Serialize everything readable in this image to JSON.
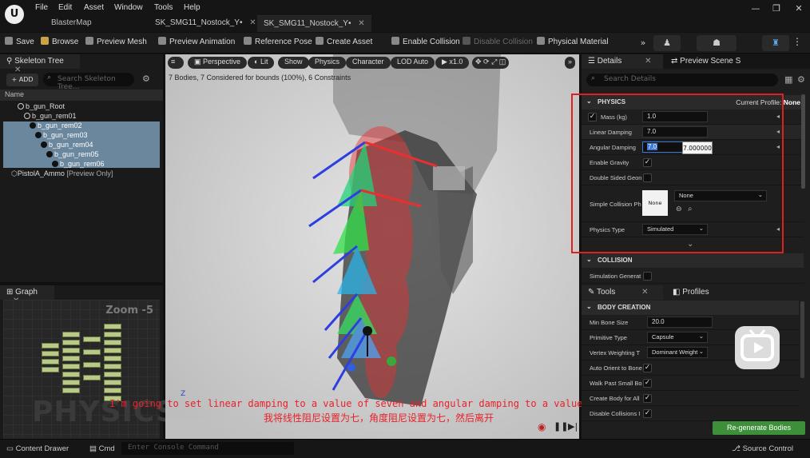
{
  "menu": [
    "File",
    "Edit",
    "Asset",
    "Window",
    "Tools",
    "Help"
  ],
  "project_tab": "BlasterMap",
  "doc_tabs": [
    "SK_SMG11_Nostock_Y•",
    "SK_SMG11_Nostock_Y•"
  ],
  "window_controls": [
    "—",
    "❐",
    "✕"
  ],
  "toolbar": {
    "save": "Save",
    "browse": "Browse",
    "preview_mesh": "Preview Mesh",
    "preview_animation": "Preview Animation",
    "reference_pose": "Reference Pose",
    "create_asset": "Create Asset",
    "enable_collision": "Enable Collision",
    "disable_collision": "Disable Collision",
    "physical_material": "Physical Material"
  },
  "skeleton_tree": {
    "tab": "Skeleton Tree",
    "add_label": "ADD",
    "search_placeholder": "Search Skeleton Tree...",
    "header": "Name",
    "bones": [
      {
        "name": "b_gun_Root",
        "indent": 1,
        "selected": false
      },
      {
        "name": "b_gun_rem01",
        "indent": 2,
        "selected": false
      },
      {
        "name": "b_gun_rem02",
        "indent": 3,
        "selected": true
      },
      {
        "name": "b_gun_rem03",
        "indent": 4,
        "selected": true
      },
      {
        "name": "b_gun_rem04",
        "indent": 5,
        "selected": true
      },
      {
        "name": "b_gun_rem05",
        "indent": 6,
        "selected": true
      },
      {
        "name": "b_gun_rem06",
        "indent": 7,
        "selected": true
      }
    ],
    "attached_item": "PistolA_Ammo",
    "attached_tag": "[Preview Only]"
  },
  "graph": {
    "tab": "Graph",
    "zoom": "Zoom -5",
    "watermark": "PHYSICS"
  },
  "viewport": {
    "perspective": "Perspective",
    "lit": "Lit",
    "show": "Show",
    "physics": "Physics",
    "character": "Character",
    "lod": "LOD Auto",
    "speed": "x1.0",
    "status": "7 Bodies, 7 Considered for bounds (100%), 6 Constraints",
    "axis_z": "Z"
  },
  "captions": {
    "en": "I'm going to set linear damping to a value of seven and angular damping to a value of seven and leave",
    "zh": "我将线性阻尼设置为七，角度阻尼设置为七，然后离开"
  },
  "details": {
    "tab": "Details",
    "tab2": "Preview Scene S",
    "search_placeholder": "Search Details",
    "physics_section": "PHYSICS",
    "profile_label": "Current Profile:",
    "profile_value": "None",
    "mass_label": "Mass (kg)",
    "mass_value": "1.0",
    "linear_damping_label": "Linear Damping",
    "linear_damping_value": "7.0",
    "angular_damping_label": "Angular Damping",
    "angular_damping_value": "7.0",
    "angular_tooltip": "7.000000",
    "enable_gravity_label": "Enable Gravity",
    "double_sided_label": "Double Sided Geon",
    "simple_collision_label": "Simple Collision Ph",
    "simple_collision_thumb": "None",
    "simple_collision_value": "None",
    "physics_type_label": "Physics Type",
    "physics_type_value": "Simulated",
    "collision_section": "COLLISION",
    "simulation_generates_label": "Simulation Generat"
  },
  "tools": {
    "tab": "Tools",
    "tab2": "Profiles",
    "section": "BODY CREATION",
    "min_bone_size_label": "Min Bone Size",
    "min_bone_size_value": "20.0",
    "primitive_type_label": "Primitive Type",
    "primitive_type_value": "Capsule",
    "vertex_weighting_label": "Vertex Weighting T",
    "vertex_weighting_value": "Dominant Weight",
    "auto_orient_label": "Auto Orient to Bone",
    "walk_past_label": "Walk Past Small Bo",
    "create_body_label": "Create Body for All",
    "disable_collisions_label": "Disable Collisions I",
    "regen_button": "Re-generate Bodies"
  },
  "bottom": {
    "content_drawer": "Content Drawer",
    "cmd": "Cmd",
    "console_placeholder": "Enter Console Command",
    "source_control": "Source Control"
  },
  "colors": {
    "accent_red": "#e02020",
    "regen_green": "#3d8f3a",
    "selection_blue": "#7a9bb5"
  }
}
